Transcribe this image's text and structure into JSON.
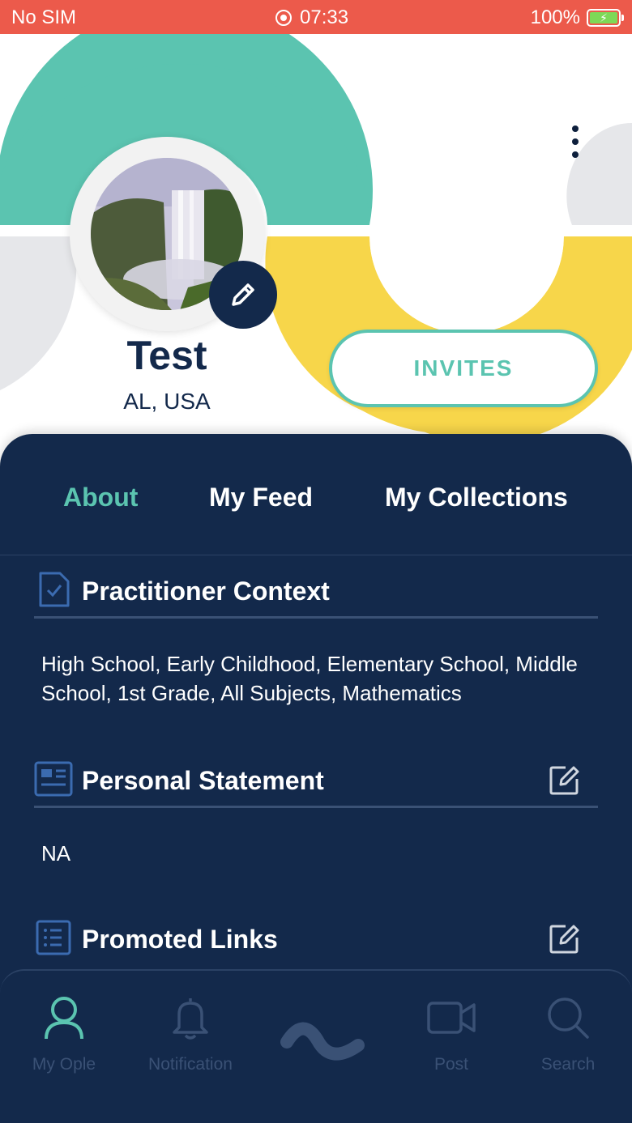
{
  "status_bar": {
    "carrier": "No SIM",
    "time": "07:33",
    "battery": "100%"
  },
  "profile": {
    "name": "Test",
    "location": "AL, USA",
    "invites_label": "INVITES"
  },
  "tabs": [
    {
      "label": "About",
      "active": true
    },
    {
      "label": "My Feed",
      "active": false
    },
    {
      "label": "My Collections",
      "active": false
    }
  ],
  "sections": {
    "practitioner": {
      "title": "Practitioner Context",
      "body": "High School, Early Childhood, Elementary School, Middle School, 1st Grade, All Subjects, Mathematics",
      "icon": "document-check-icon"
    },
    "statement": {
      "title": "Personal Statement",
      "body": "NA",
      "icon": "id-card-icon"
    },
    "links": {
      "title": "Promoted Links",
      "icon": "list-icon"
    }
  },
  "bottom_nav": [
    {
      "label": "My Ople",
      "icon": "user-icon",
      "active": true
    },
    {
      "label": "Notification",
      "icon": "bell-icon",
      "active": false
    },
    {
      "label": "",
      "icon": "ople-logo-icon",
      "active": false
    },
    {
      "label": "Post",
      "icon": "video-camera-icon",
      "active": false
    },
    {
      "label": "Search",
      "icon": "search-icon",
      "active": false
    }
  ],
  "colors": {
    "status_bar": "#ec5a4b",
    "teal": "#5bc4b0",
    "yellow": "#f7d64a",
    "navy": "#13294b",
    "grey_shape": "#e6e7ea"
  }
}
